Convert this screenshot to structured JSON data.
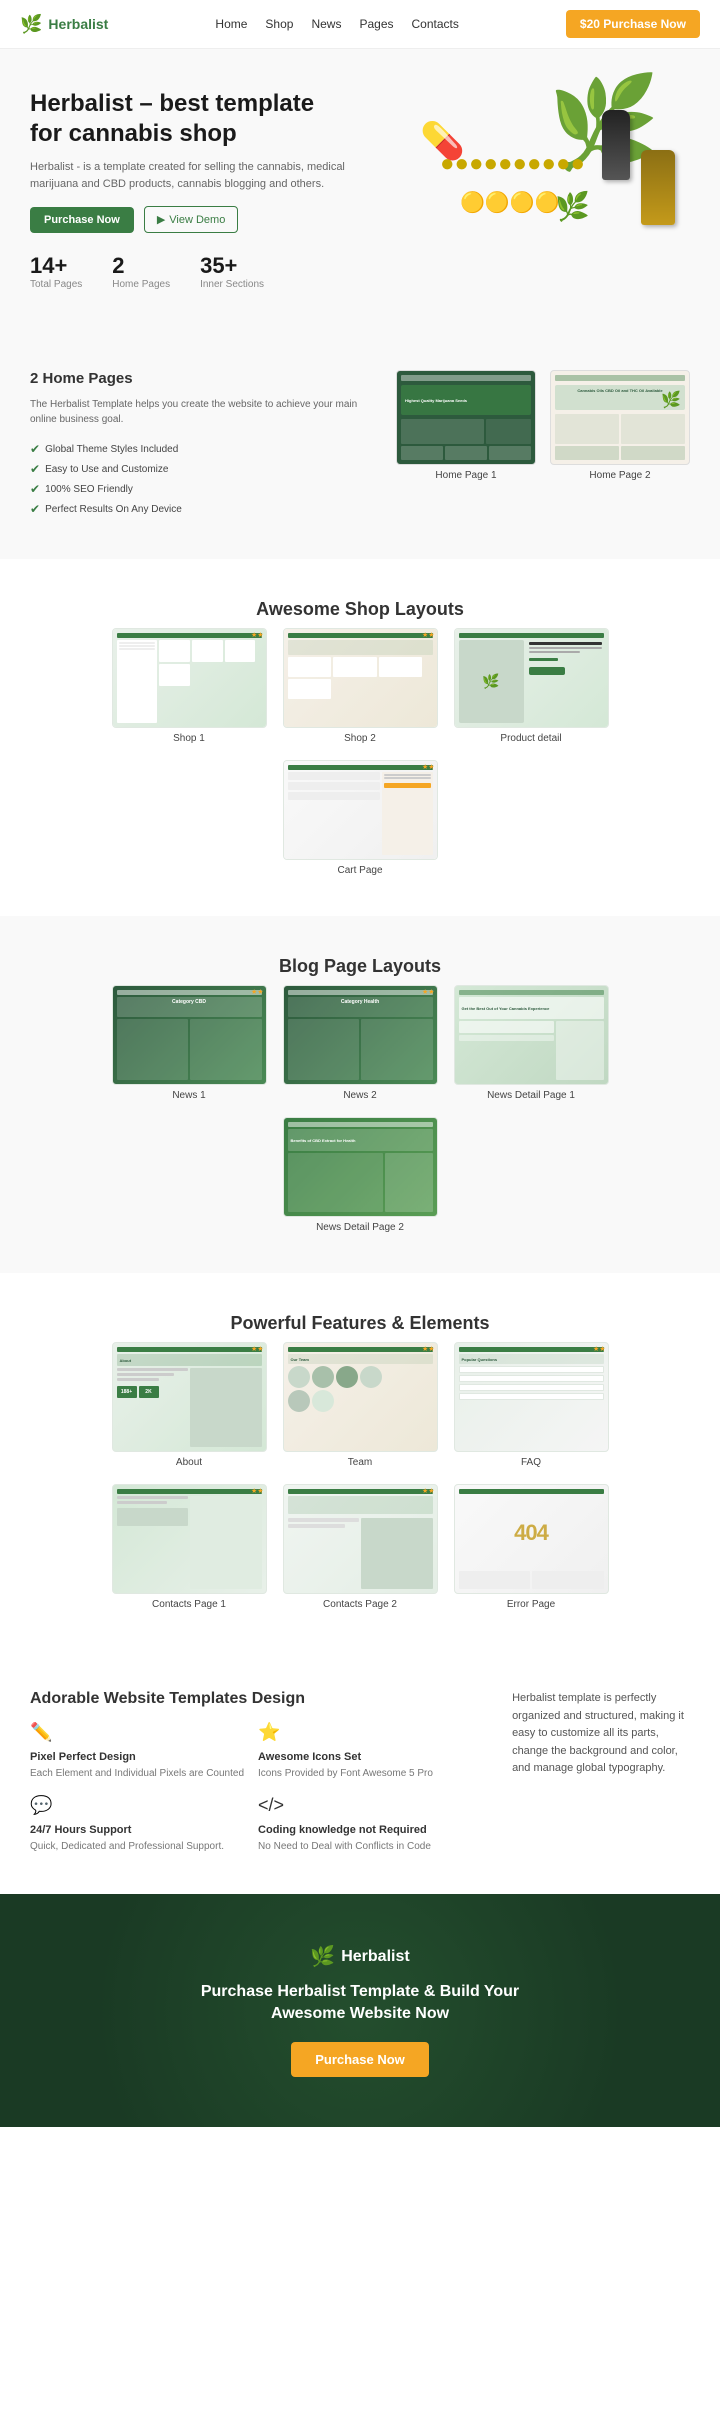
{
  "nav": {
    "logo": "Herbalist",
    "links": [
      {
        "label": "Home",
        "has_dropdown": true
      },
      {
        "label": "Shop",
        "has_dropdown": true
      },
      {
        "label": "News",
        "has_dropdown": false
      },
      {
        "label": "Pages",
        "has_dropdown": true
      },
      {
        "label": "Contacts",
        "has_dropdown": true
      }
    ],
    "cta_label": "$20 Purchase Now"
  },
  "hero": {
    "title": "Herbalist – best template for cannabis shop",
    "description": "Herbalist - is a template created for selling the cannabis, medical marijuana and CBD products, cannabis blogging and others.",
    "btn_purchase": "Purchase Now",
    "btn_demo": "View Demo",
    "stats": [
      {
        "number": "14+",
        "label": "Total Pages"
      },
      {
        "number": "2",
        "label": "Home Pages"
      },
      {
        "number": "35+",
        "label": "Inner Sections"
      }
    ]
  },
  "home_pages": {
    "title": "2 Home Pages",
    "description": "The Herbalist Template helps you create the website to achieve your main online business goal.",
    "features": [
      "Global Theme Styles Included",
      "Easy to Use and Customize",
      "100% SEO Friendly",
      "Perfect Results On Any Device"
    ],
    "pages": [
      {
        "label": "Home Page 1"
      },
      {
        "label": "Home Page 2"
      }
    ]
  },
  "shop_section": {
    "title": "Awesome Shop Layouts",
    "pages": [
      {
        "label": "Shop 1"
      },
      {
        "label": "Shop 2"
      },
      {
        "label": "Product detail"
      },
      {
        "label": "Cart Page"
      }
    ]
  },
  "blog_section": {
    "title": "Blog Page Layouts",
    "pages": [
      {
        "label": "News 1"
      },
      {
        "label": "News 2"
      },
      {
        "label": "News Detail Page 1"
      },
      {
        "label": "News Detail Page 2"
      }
    ]
  },
  "features_section": {
    "title": "Powerful Features & Elements",
    "pages": [
      {
        "label": "About"
      },
      {
        "label": "Team"
      },
      {
        "label": "FAQ"
      },
      {
        "label": "Contacts Page 1"
      },
      {
        "label": "Contacts Page 2"
      },
      {
        "label": "Error Page"
      }
    ]
  },
  "adorable": {
    "left_title": "Adorable Website Templates Design",
    "right_text": "Herbalist template is perfectly organized and structured, making it easy to customize all its parts, change the background and color, and manage global typography.",
    "features": [
      {
        "icon": "✏️",
        "title": "Pixel Perfect Design",
        "desc": "Each Element and Individual Pixels are Counted"
      },
      {
        "icon": "⭐",
        "title": "Awesome Icons Set",
        "desc": "Icons Provided by Font Awesome 5 Pro"
      },
      {
        "icon": "💬",
        "title": "24/7 Hours Support",
        "desc": "Quick, Dedicated and Professional Support."
      },
      {
        "icon": "</>",
        "title": "Coding knowledge not Required",
        "desc": "No Need to Deal with Conflicts in Code"
      }
    ]
  },
  "footer_cta": {
    "logo": "Herbalist",
    "title": "Purchase Herbalist Template & Build Your Awesome Website Now",
    "btn_label": "Purchase Now"
  }
}
